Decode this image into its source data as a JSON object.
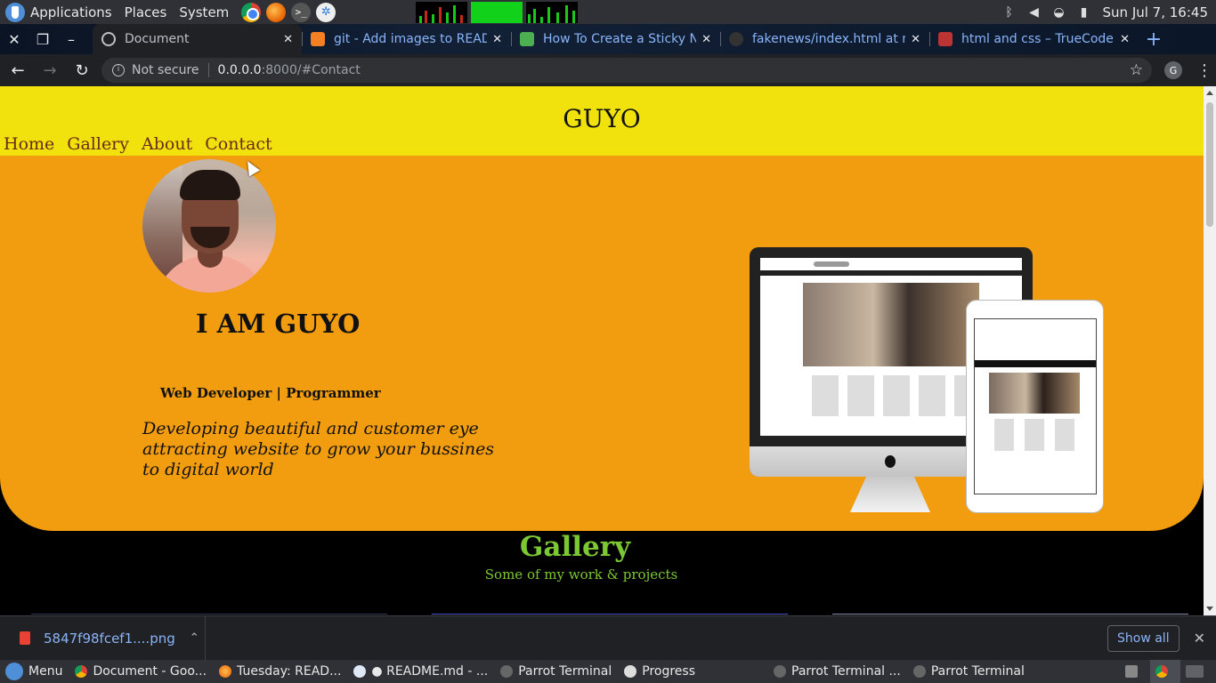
{
  "os_panel": {
    "menus": [
      "Applications",
      "Places",
      "System"
    ],
    "clock": "Sun Jul 7, 16:45"
  },
  "browser": {
    "tabs": [
      {
        "title": "Document",
        "favicon": "globe-icon",
        "active": true
      },
      {
        "title": "git - Add images to READ",
        "favicon": "stackoverflow-icon",
        "active": false
      },
      {
        "title": "How To Create a Sticky N",
        "favicon": "w3schools-icon",
        "active": false
      },
      {
        "title": "fakenews/index.html at m",
        "favicon": "github-icon",
        "active": false
      },
      {
        "title": "html and css – TrueCode",
        "favicon": "truecode-icon",
        "active": false
      }
    ],
    "security_label": "Not secure",
    "url_host": "0.0.0.0",
    "url_rest": ":8000/#Contact",
    "profile_initial": "G"
  },
  "site": {
    "brand": "GUYO",
    "nav": [
      "Home",
      "Gallery",
      "About",
      "Contact"
    ],
    "hero": {
      "heading": "I AM GUYO",
      "role": "Web Developer | Programmer",
      "tagline": "Developing beautiful and customer eye attracting website to grow your bussines to digital world"
    },
    "gallery": {
      "title": "Gallery",
      "subtitle": "Some of my work & projects"
    },
    "colors": {
      "header_bg": "#f1e20d",
      "hero_bg": "#f29c10",
      "gallery_accent": "#7cc833"
    }
  },
  "downloads": {
    "file_name": "5847f98fcef1....png",
    "show_all": "Show all"
  },
  "taskbar": {
    "menu_label": "Menu",
    "items": [
      {
        "label": "Document - Goo...",
        "icon": "chrome-icon",
        "active": false
      },
      {
        "label": "Tuesday: READ...",
        "icon": "firefox-icon",
        "active": false
      },
      {
        "label": "● README.md - ...",
        "icon": "vscode-icon",
        "active": false
      },
      {
        "label": "Parrot Terminal",
        "icon": "terminal-icon",
        "active": false
      },
      {
        "label": "Progress",
        "icon": "clock-icon",
        "active": false
      },
      {
        "label": "Parrot Terminal ...",
        "icon": "terminal-icon",
        "active": false
      },
      {
        "label": "Parrot Terminal",
        "icon": "terminal-icon",
        "active": false
      }
    ]
  }
}
